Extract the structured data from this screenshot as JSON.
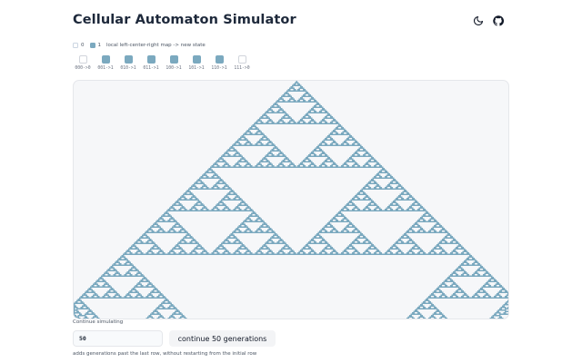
{
  "header": {
    "title": "Cellular Automaton Simulator",
    "icons": [
      "moon-icon",
      "github-icon"
    ]
  },
  "legend": {
    "off_label": "0",
    "on_label": "1",
    "description": "local left-center-right map -> new state"
  },
  "rules": [
    {
      "label": "000->0",
      "state": 0
    },
    {
      "label": "001->1",
      "state": 1
    },
    {
      "label": "010->1",
      "state": 1
    },
    {
      "label": "011->1",
      "state": 1
    },
    {
      "label": "100->1",
      "state": 1
    },
    {
      "label": "101->1",
      "state": 1
    },
    {
      "label": "110->1",
      "state": 1
    },
    {
      "label": "111->0",
      "state": 0
    }
  ],
  "colors": {
    "on": "#7ba9bf",
    "canvas_bg": "#f6f7f9",
    "border": "#e5e7eb"
  },
  "continue": {
    "label": "Continue simulating",
    "generations_value": "50",
    "button_label": "continue 50 generations",
    "hint": "adds generations past the last row, without restarting from the initial row"
  }
}
